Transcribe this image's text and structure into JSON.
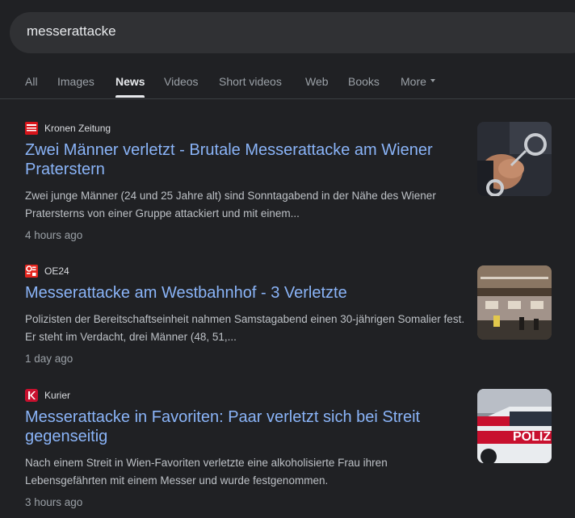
{
  "search": {
    "query": "messerattacke"
  },
  "tabs": [
    {
      "label": "All"
    },
    {
      "label": "Images"
    },
    {
      "label": "News"
    },
    {
      "label": "Videos"
    },
    {
      "label": "Short videos"
    },
    {
      "label": "Web"
    },
    {
      "label": "Books"
    },
    {
      "label": "More"
    }
  ],
  "active_tab": "News",
  "results": [
    {
      "source": "Kronen Zeitung",
      "favicon_text": "Krone Zeitung",
      "favicon_color": "#d7141a",
      "headline": "Zwei Männer verletzt - Brutale Messerattacke am Wiener Praterstern",
      "snippet": "Zwei junge Männer (24 und 25 Jahre alt) sind Sonntagabend in der Nähe des Wiener Pratersterns von einer Gruppe attackiert und mit einem...",
      "time": "4 hours ago",
      "thumbnail": "handcuffs-image"
    },
    {
      "source": "OE24",
      "favicon_text": "OE24",
      "favicon_color": "#e4251e",
      "headline": "Messerattacke am Westbahnhof - 3 Verletzte",
      "snippet": "Polizisten der Bereitschaftseinheit nahmen Samstagabend einen 30-jährigen Somalier fest. Er steht im Verdacht, drei Männer (48, 51,...",
      "time": "1 day ago",
      "thumbnail": "station-hall-image"
    },
    {
      "source": "Kurier",
      "favicon_text": "K",
      "favicon_color": "#c8102e",
      "headline": "Messerattacke in Favoriten: Paar verletzt sich bei Streit gegenseitig",
      "snippet": "Nach einem Streit in Wien-Favoriten verletzte eine alkoholisierte Frau ihren Lebensgefährten mit einem Messer und wurde festgenommen.",
      "time": "3 hours ago",
      "thumbnail": "police-car-image",
      "thumbnail_text": "POLIZ"
    }
  ]
}
